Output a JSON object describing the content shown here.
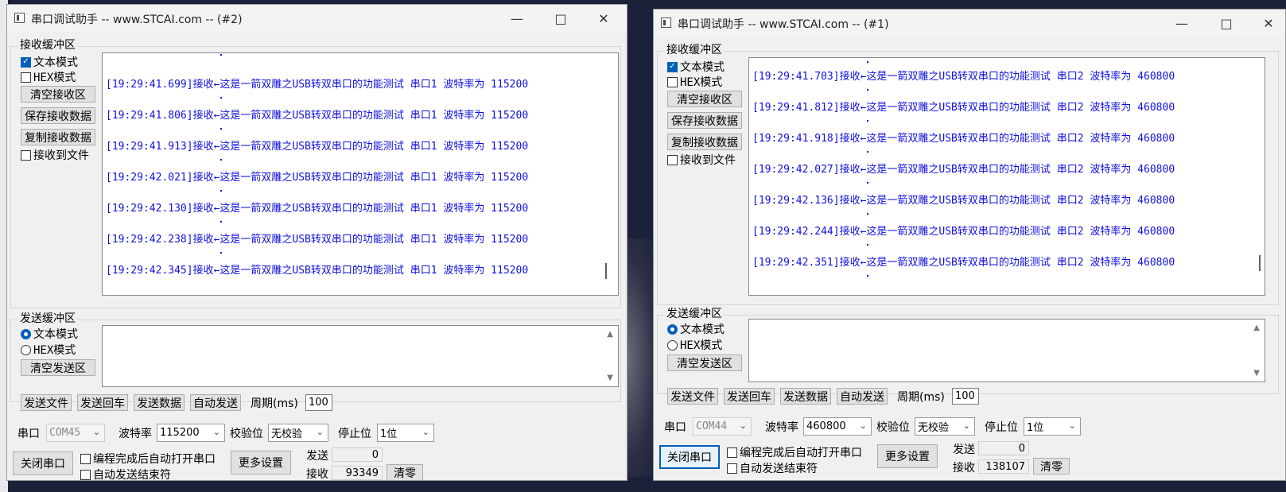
{
  "win2": {
    "title": "串口调试助手 -- www.STCAI.com -- (#2)",
    "receive_group": "接收缓冲区",
    "text_mode": "文本模式",
    "hex_mode": "HEX模式",
    "clear_receive": "清空接收区",
    "save_receive": "保存接收数据",
    "copy_receive": "复制接收数据",
    "receive_to_file": "接收到文件",
    "lines": [
      "[19:29:41.699]接收←这是一箭双雕之USB转双串口的功能测试 串口1 波特率为 115200",
      "[19:29:41.806]接收←这是一箭双雕之USB转双串口的功能测试 串口1 波特率为 115200",
      "[19:29:41.913]接收←这是一箭双雕之USB转双串口的功能测试 串口1 波特率为 115200",
      "[19:29:42.021]接收←这是一箭双雕之USB转双串口的功能测试 串口1 波特率为 115200",
      "[19:29:42.130]接收←这是一箭双雕之USB转双串口的功能测试 串口1 波特率为 115200",
      "[19:29:42.238]接收←这是一箭双雕之USB转双串口的功能测试 串口1 波特率为 115200",
      "[19:29:42.345]接收←这是一箭双雕之USB转双串口的功能测试 串口1 波特率为 115200"
    ],
    "send_group": "发送缓冲区",
    "clear_send": "清空发送区",
    "send_file": "发送文件",
    "send_return": "发送回车",
    "send_data": "发送数据",
    "auto_send": "自动发送",
    "period_label": "周期(ms)",
    "period_value": "100",
    "port_label": "串口",
    "port_value": "COM45",
    "baud_label": "波特率",
    "baud_value": "115200",
    "parity_label": "校验位",
    "parity_value": "无校验",
    "stop_label": "停止位",
    "stop_value": "1位",
    "close_port": "关闭串口",
    "auto_open": "编程完成后自动打开串口",
    "auto_send_end": "自动发送结束符",
    "more_settings": "更多设置",
    "sent_label": "发送",
    "sent_value": "0",
    "recv_label": "接收",
    "recv_value": "93349",
    "clear_counts": "清零"
  },
  "win1": {
    "title": "串口调试助手 -- www.STCAI.com -- (#1)",
    "receive_group": "接收缓冲区",
    "text_mode": "文本模式",
    "hex_mode": "HEX模式",
    "clear_receive": "清空接收区",
    "save_receive": "保存接收数据",
    "copy_receive": "复制接收数据",
    "receive_to_file": "接收到文件",
    "lines": [
      "[19:29:41.703]接收←这是一箭双雕之USB转双串口的功能测试 串口2 波特率为 460800",
      "[19:29:41.812]接收←这是一箭双雕之USB转双串口的功能测试 串口2 波特率为 460800",
      "[19:29:41.918]接收←这是一箭双雕之USB转双串口的功能测试 串口2 波特率为 460800",
      "[19:29:42.027]接收←这是一箭双雕之USB转双串口的功能测试 串口2 波特率为 460800",
      "[19:29:42.136]接收←这是一箭双雕之USB转双串口的功能测试 串口2 波特率为 460800",
      "[19:29:42.244]接收←这是一箭双雕之USB转双串口的功能测试 串口2 波特率为 460800",
      "[19:29:42.351]接收←这是一箭双雕之USB转双串口的功能测试 串口2 波特率为 460800"
    ],
    "send_group": "发送缓冲区",
    "clear_send": "清空发送区",
    "send_file": "发送文件",
    "send_return": "发送回车",
    "send_data": "发送数据",
    "auto_send": "自动发送",
    "period_label": "周期(ms)",
    "period_value": "100",
    "port_label": "串口",
    "port_value": "COM44",
    "baud_label": "波特率",
    "baud_value": "460800",
    "parity_label": "校验位",
    "parity_value": "无校验",
    "stop_label": "停止位",
    "stop_value": "1位",
    "close_port": "关闭串口",
    "auto_open": "编程完成后自动打开串口",
    "auto_send_end": "自动发送结束符",
    "more_settings": "更多设置",
    "sent_label": "发送",
    "sent_value": "0",
    "recv_label": "接收",
    "recv_value": "138107",
    "clear_counts": "清零"
  },
  "colors": {
    "rx_text": "#1010e0",
    "accent": "#005fb8",
    "window_bg": "#f0f0f0"
  }
}
